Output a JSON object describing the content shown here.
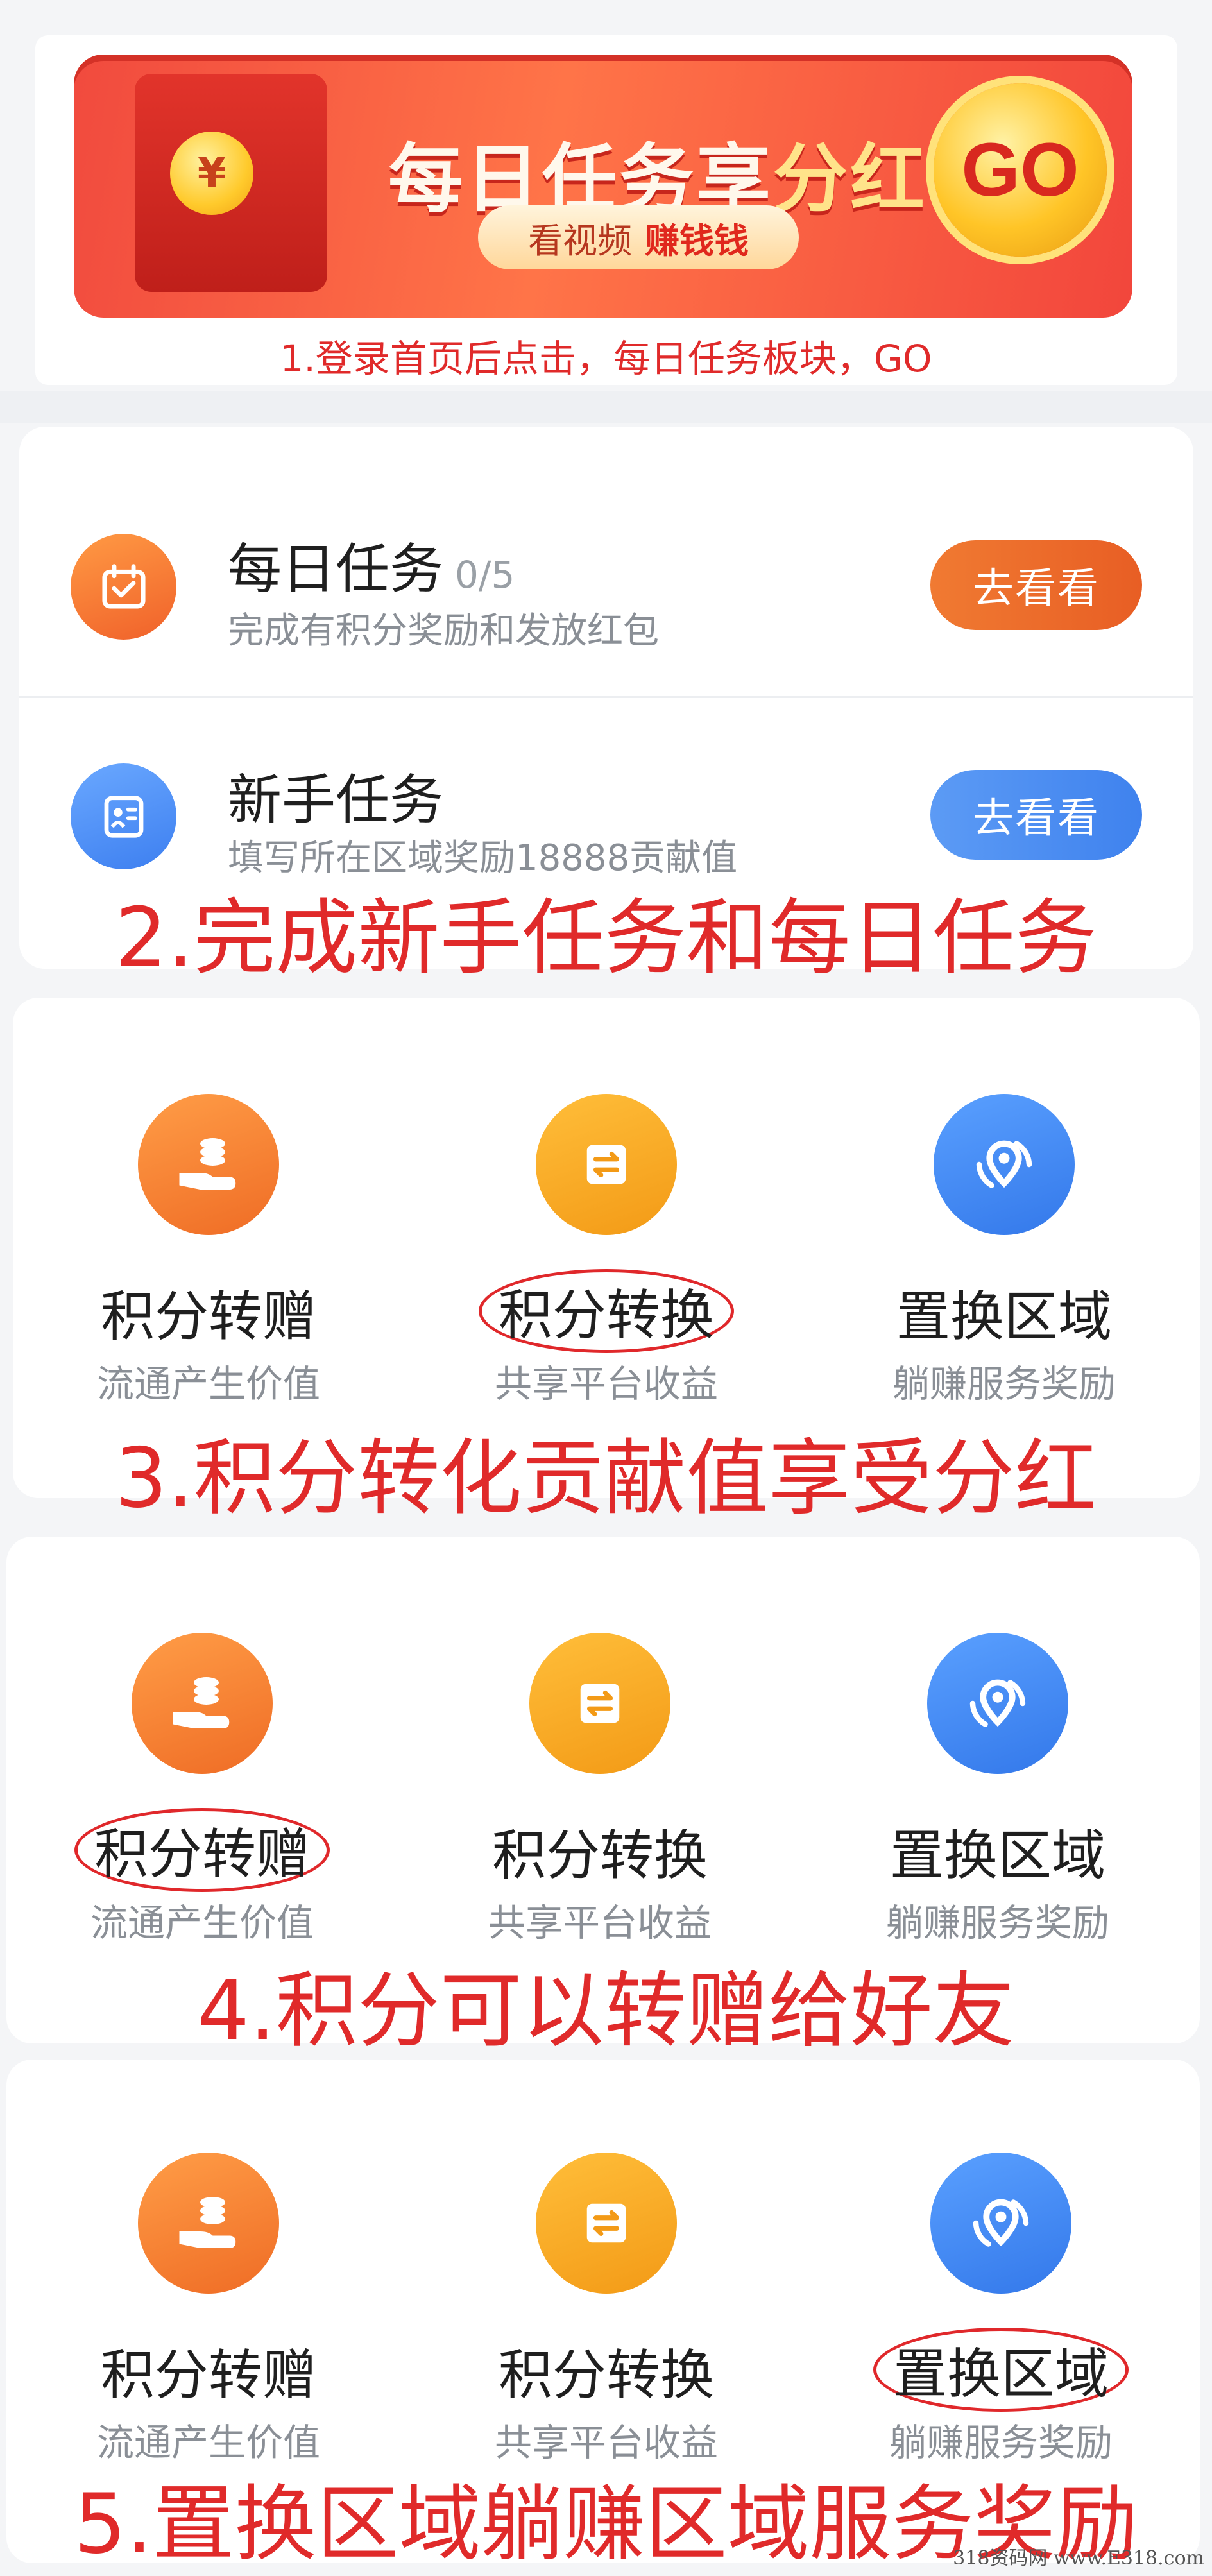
{
  "banner": {
    "title_main": "每日任务享",
    "title_highlight": "分红",
    "pill_prefix": "看视频",
    "pill_emphasis": "赚钱钱",
    "go_label": "GO",
    "coin_symbol": "¥"
  },
  "annotations": {
    "step1": "1.登录首页后点击，每日任务板块，GO",
    "step2": "2.完成新手任务和每日任务",
    "step3": "3.积分转化贡献值享受分红",
    "step4": "4.积分可以转赠给好友",
    "step5": "5.置换区域躺赚区域服务奖励"
  },
  "tasks": [
    {
      "title": "每日任务",
      "count": "0/5",
      "subtitle": "完成有积分奖励和发放红包",
      "button": "去看看",
      "color": "#f06a2a",
      "icon": "calendar-icon"
    },
    {
      "title": "新手任务",
      "count": "",
      "subtitle": "填写所在区域奖励18888贡献值",
      "button": "去看看",
      "color": "#4d8ff0",
      "icon": "id-card-icon"
    }
  ],
  "features": [
    {
      "label": "积分转赠",
      "subtitle": "流通产生价值",
      "icon": "coin-hand-icon"
    },
    {
      "label": "积分转换",
      "subtitle": "共享平台收益",
      "icon": "exchange-icon"
    },
    {
      "label": "置换区域",
      "subtitle": "躺赚服务奖励",
      "icon": "location-swap-icon"
    }
  ],
  "colors": {
    "annotation": "#e02a2a",
    "orange": "#f07a28",
    "gold": "#f5a61c",
    "blue": "#3f86ef"
  },
  "watermark": "318资码网 www.E318.com"
}
